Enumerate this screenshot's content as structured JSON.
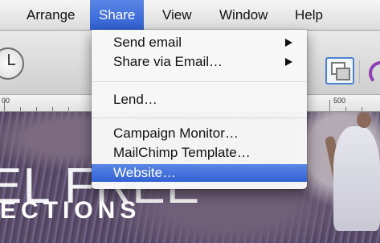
{
  "menubar": {
    "items": [
      {
        "label": "Arrange"
      },
      {
        "label": "Share"
      },
      {
        "label": "View"
      },
      {
        "label": "Window"
      },
      {
        "label": "Help"
      }
    ],
    "active": "Share"
  },
  "share_menu": {
    "items": [
      {
        "label": "Send email",
        "submenu": true
      },
      {
        "label": "Share via Email…",
        "submenu": true
      },
      {
        "label": "Lend…"
      },
      {
        "label": "Campaign Monitor…"
      },
      {
        "label": "MailChimp Template…"
      },
      {
        "label": "Website…",
        "highlighted": true
      }
    ]
  },
  "ruler": {
    "labels": [
      "00",
      "500"
    ]
  },
  "canvas": {
    "headline": "EL FREE",
    "subline": "ECTIONS"
  },
  "colors": {
    "highlight": "#3a6bd9",
    "menu_bg": "#f7f7f7",
    "accent_purple": "#8e3fb0"
  }
}
